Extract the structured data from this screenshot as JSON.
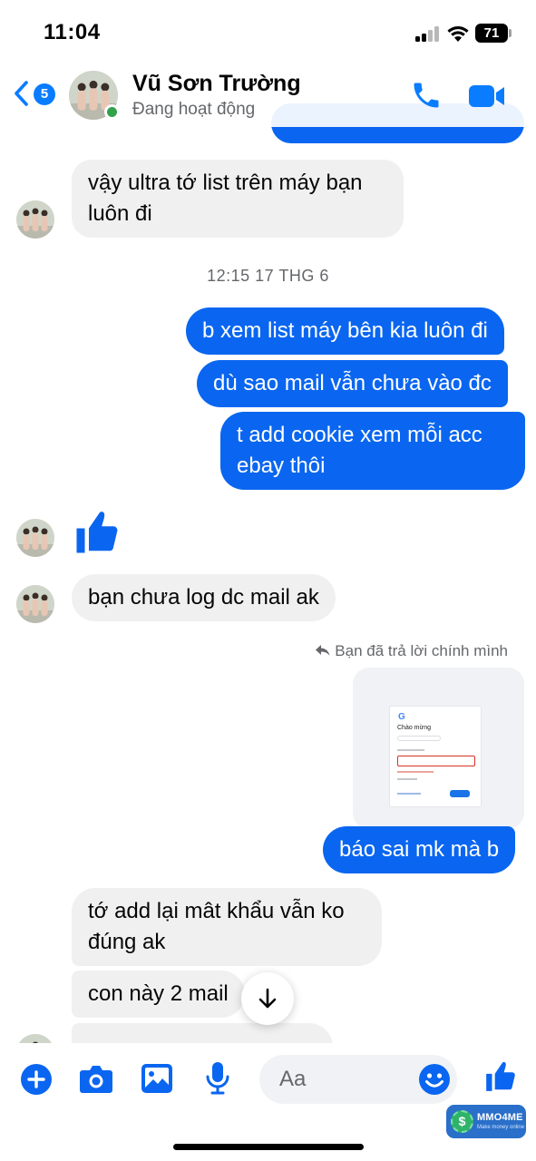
{
  "status_bar": {
    "time": "11:04",
    "battery": "71"
  },
  "header": {
    "back_count": "5",
    "contact_name": "Vũ Sơn Trường",
    "contact_status": "Đang hoạt động"
  },
  "messages": {
    "m0": "",
    "m1_line1": "vậy ultra tớ list trên máy bạn",
    "m1_line2": "luôn đi",
    "timestamp": "12:15 17 THG 6",
    "m2": "b xem list máy bên kia luôn đi",
    "m3": "dù sao mail vẫn chưa vào đc",
    "m4_line1": "t add cookie xem mỗi acc",
    "m4_line2": "ebay thôi",
    "m5": "bạn chưa log dc mail ak",
    "reply_note": "Bạn đã trả lời chính mình",
    "attachment": {
      "logo": "G",
      "title": "Chào mừng"
    },
    "m6": "báo sai mk mà b",
    "m7_line1": "tớ add lại mât khẩu vẫn ko",
    "m7_line2": "đúng ak",
    "m8": "con này 2 mail",
    "m9": ""
  },
  "composer": {
    "placeholder": "Aa"
  },
  "watermark": {
    "brand": "MMO4ME",
    "tagline": "Make money online",
    "symbol": "$"
  },
  "colors": {
    "accent": "#0a7cff",
    "outgoing_bubble": "#0a66f0",
    "incoming_bubble": "#f0f0f0",
    "online": "#31a24c"
  },
  "icons": [
    "back-chevron-icon",
    "phone-icon",
    "video-camera-icon",
    "thumbs-up-icon",
    "arrow-down-icon",
    "plus-icon",
    "camera-icon",
    "image-icon",
    "microphone-icon",
    "emoji-icon",
    "reply-icon"
  ]
}
